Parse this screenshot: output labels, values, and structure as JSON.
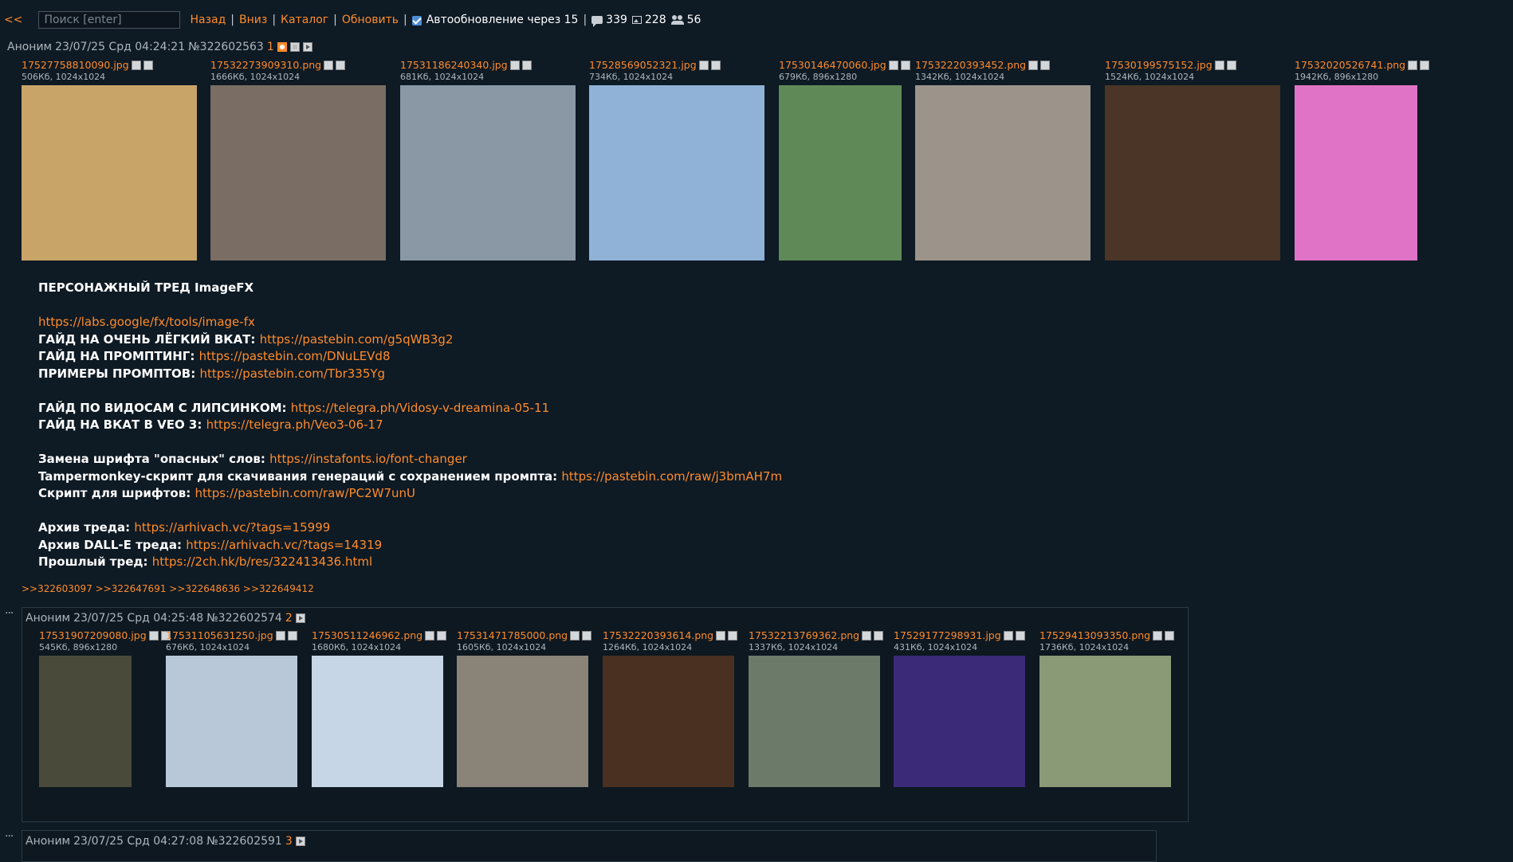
{
  "topbar": {
    "back_label": "<<",
    "search_placeholder": "Поиск [enter]",
    "nav": [
      "Назад",
      "Вниз",
      "Каталог",
      "Обновить"
    ],
    "autoupdate_label": "Автообновление через 15",
    "autoupdate_checked": true,
    "stats": {
      "posts": "339",
      "images": "228",
      "users": "56"
    }
  },
  "op": {
    "name": "Аноним",
    "date": "23/07/25 Срд 04:24:21",
    "postnum": "№322602563",
    "index": "1",
    "files": [
      {
        "name": "17527758810090.jpg",
        "meta": "506Кб, 1024x1024",
        "thumb_color": "#c9a468"
      },
      {
        "name": "17532273909310.png",
        "meta": "1666Кб, 1024x1024",
        "thumb_color": "#7a6d63"
      },
      {
        "name": "17531186240340.jpg",
        "meta": "681Кб, 1024x1024",
        "thumb_color": "#8a98a6"
      },
      {
        "name": "17528569052321.jpg",
        "meta": "734Кб, 1024x1024",
        "thumb_color": "#8fb2d6"
      },
      {
        "name": "17530146470060.jpg",
        "meta": "679Кб, 896x1280",
        "thumb_color": "#5f8a58"
      },
      {
        "name": "17532220393452.png",
        "meta": "1342Кб, 1024x1024",
        "thumb_color": "#9c948a"
      },
      {
        "name": "17530199575152.jpg",
        "meta": "1524Кб, 1024x1024",
        "thumb_color": "#4a3526"
      },
      {
        "name": "17532020526741.png",
        "meta": "1942Кб, 896x1280",
        "thumb_color": "#e173c6"
      }
    ],
    "lines": [
      {
        "bold": "ПЕРСОНАЖНЫЙ ТРЕД ImageFX",
        "link": ""
      },
      {
        "bold": "",
        "link": ""
      },
      {
        "bold": "",
        "link": "https://labs.google/fx/tools/image-fx"
      },
      {
        "bold": "ГАЙД НА ОЧЕНЬ ЛЁГКИЙ ВКАТ: ",
        "link": "https://pastebin.com/g5qWB3g2"
      },
      {
        "bold": "ГАЙД НА ПРОМПТИНГ: ",
        "link": "https://pastebin.com/DNuLEVd8"
      },
      {
        "bold": "ПРИМЕРЫ ПРОМПТОВ: ",
        "link": "https://pastebin.com/Tbr335Yg"
      },
      {
        "bold": "",
        "link": ""
      },
      {
        "bold": "ГАЙД ПО ВИДОСАМ С ЛИПСИНКОМ: ",
        "link": "https://telegra.ph/Vidosy-v-dreamina-05-11"
      },
      {
        "bold": "ГАЙД НА ВКАТ В VEO 3: ",
        "link": "https://telegra.ph/Veo3-06-17"
      },
      {
        "bold": "",
        "link": ""
      },
      {
        "bold": "Замена шрифта \"опасных\" слов: ",
        "link": "https://instafonts.io/font-changer"
      },
      {
        "bold": "Tampermonkey-скрипт для скачивания генераций с сохранением промпта: ",
        "link": "https://pastebin.com/raw/j3bmAH7m"
      },
      {
        "bold": "Скрипт для шрифтов: ",
        "link": "https://pastebin.com/raw/PC2W7unU"
      },
      {
        "bold": "",
        "link": ""
      },
      {
        "bold": "Архив треда: ",
        "link": "https://arhivach.vc/?tags=15999"
      },
      {
        "bold": "Архив DALL-E треда: ",
        "link": "https://arhivach.vc/?tags=14319"
      },
      {
        "bold": "Прошлый тред: ",
        "link": "https://2ch.hk/b/res/322413436.html"
      }
    ],
    "replies": ">>322603097 >>322647691 >>322648636 >>322649412"
  },
  "post2": {
    "dots": "···",
    "name": "Аноним",
    "date": "23/07/25 Срд 04:25:48",
    "postnum": "№322602574",
    "index": "2",
    "files": [
      {
        "name": "17531907209080.jpg",
        "meta": "545Кб, 896x1280",
        "thumb_color": "#4a4a3a"
      },
      {
        "name": "17531105631250.jpg",
        "meta": "676Кб, 1024x1024",
        "thumb_color": "#b8c8d8"
      },
      {
        "name": "17530511246962.png",
        "meta": "1680Кб, 1024x1024",
        "thumb_color": "#c6d6e6"
      },
      {
        "name": "17531471785000.png",
        "meta": "1605Кб, 1024x1024",
        "thumb_color": "#8a8478"
      },
      {
        "name": "17532220393614.png",
        "meta": "1264Кб, 1024x1024",
        "thumb_color": "#4a3020"
      },
      {
        "name": "17532213769362.png",
        "meta": "1337Кб, 1024x1024",
        "thumb_color": "#6c7a6a"
      },
      {
        "name": "17529177298931.jpg",
        "meta": "431Кб, 1024x1024",
        "thumb_color": "#3a2a78"
      },
      {
        "name": "17529413093350.png",
        "meta": "1736Кб, 1024x1024",
        "thumb_color": "#8a9a76"
      }
    ]
  },
  "post3": {
    "dots": "···",
    "name": "Аноним",
    "date": "23/07/25 Срд 04:27:08",
    "postnum": "№322602591",
    "index": "3"
  }
}
